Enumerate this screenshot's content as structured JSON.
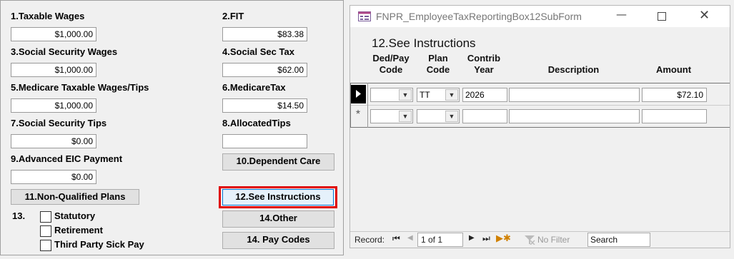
{
  "left": {
    "taxable_wages": {
      "label": "1.Taxable Wages",
      "value": "$1,000.00"
    },
    "fit": {
      "label": "2.FIT",
      "value": "$83.38"
    },
    "ss_wages": {
      "label": "3.Social Security Wages",
      "value": "$1,000.00"
    },
    "ss_tax": {
      "label": "4.Social Sec Tax",
      "value": "$62.00"
    },
    "medicare_wages": {
      "label": "5.Medicare Taxable Wages/Tips",
      "value": "$1,000.00"
    },
    "medicare_tax": {
      "label": "6.MedicareTax",
      "value": "$14.50"
    },
    "ss_tips": {
      "label": "7.Social Security Tips",
      "value": "$0.00"
    },
    "allocated_tips": {
      "label": "8.AllocatedTips",
      "value": ""
    },
    "eic": {
      "label": "9.Advanced EIC Payment",
      "value": "$0.00"
    },
    "dependent_care_btn": "10.Dependent Care",
    "non_qualified_btn": "11.Non-Qualified Plans",
    "see_instructions_btn": "12.See Instructions",
    "other_btn": "14.Other",
    "pay_codes_btn": "14. Pay Codes",
    "box13_label": "13.",
    "checkboxes": [
      "Statutory",
      "Retirement",
      "Third Party Sick Pay"
    ]
  },
  "subform": {
    "title": "FNPR_EmployeeTaxReportingBox12SubForm",
    "heading": "12.See Instructions",
    "columns": {
      "ded": [
        "Ded/Pay",
        "Code"
      ],
      "plan": [
        "Plan",
        "Code"
      ],
      "contrib": [
        "Contrib",
        "Year"
      ],
      "description": "Description",
      "amount": "Amount"
    },
    "rows": [
      {
        "ded_code": "",
        "plan_code": "TT",
        "year": "2026",
        "description": "",
        "amount": "$72.10"
      }
    ],
    "new_row_marker": "*",
    "nav": {
      "record_label": "Record:",
      "position": "1 of 1",
      "filter": "No Filter",
      "search_placeholder": "Search"
    }
  },
  "colors": {
    "highlight": "#e00000",
    "window_bg": "#f0f0f0"
  }
}
